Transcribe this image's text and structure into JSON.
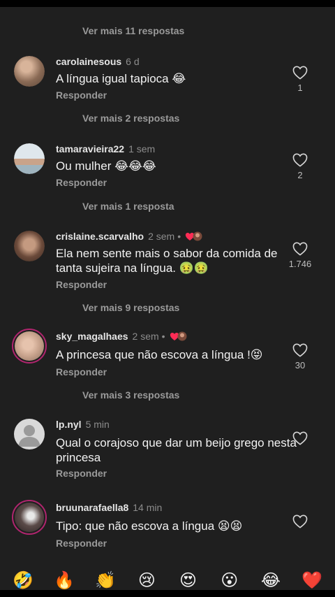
{
  "replies_links": [
    "Ver mais 11 respostas",
    "Ver mais 2 respostas",
    "Ver mais 1 resposta",
    "Ver mais 9 respostas",
    "Ver mais 3 respostas"
  ],
  "comments": [
    {
      "username": "carolainesous",
      "time": "6 d",
      "text": "A língua igual tapioca 😂",
      "reply": "Responder",
      "likes": "1",
      "avatar_color": "#8a6a55",
      "liked_by_creator": false
    },
    {
      "username": "tamaravieira22",
      "time": "1 sem",
      "text": "Ou mulher 😂😂😂",
      "reply": "Responder",
      "likes": "2",
      "avatar_color": "#b7c2c8",
      "liked_by_creator": false
    },
    {
      "username": "crislaine.scarvalho",
      "time": "2 sem",
      "text": "Ela nem sente mais o sabor da comida de tanta sujeira na língua. 🤢🤢",
      "reply": "Responder",
      "likes": "1.746",
      "avatar_color": "#6b4a3a",
      "liked_by_creator": true
    },
    {
      "username": "sky_magalhaes",
      "time": "2 sem",
      "text": "A princesa que não escova a língua !😝",
      "reply": "Responder",
      "likes": "30",
      "avatar_color": "#c9a48e",
      "liked_by_creator": true
    },
    {
      "username": "lp.nyl",
      "time": "5 min",
      "text": "Qual o corajoso que dar um beijo grego nesta princesa",
      "reply": "Responder",
      "likes": "",
      "avatar_color": "#d9d9d9",
      "liked_by_creator": false
    },
    {
      "username": "bruunarafaella8",
      "time": "14 min",
      "text": "Tipo: que não escova a língua 😫😫",
      "reply": "Responder",
      "likes": "",
      "avatar_color": "#3a3030",
      "liked_by_creator": false
    }
  ],
  "emoji_bar": [
    "🤣",
    "🔥",
    "👏",
    "😢",
    "😍",
    "😮",
    "😂",
    "❤️"
  ],
  "icons": {
    "like": "heart-outline-icon",
    "creator_like": "heart-filled-icon"
  },
  "colors": {
    "background": "#1f1f1f",
    "creator_heart": "#fe2c55"
  }
}
